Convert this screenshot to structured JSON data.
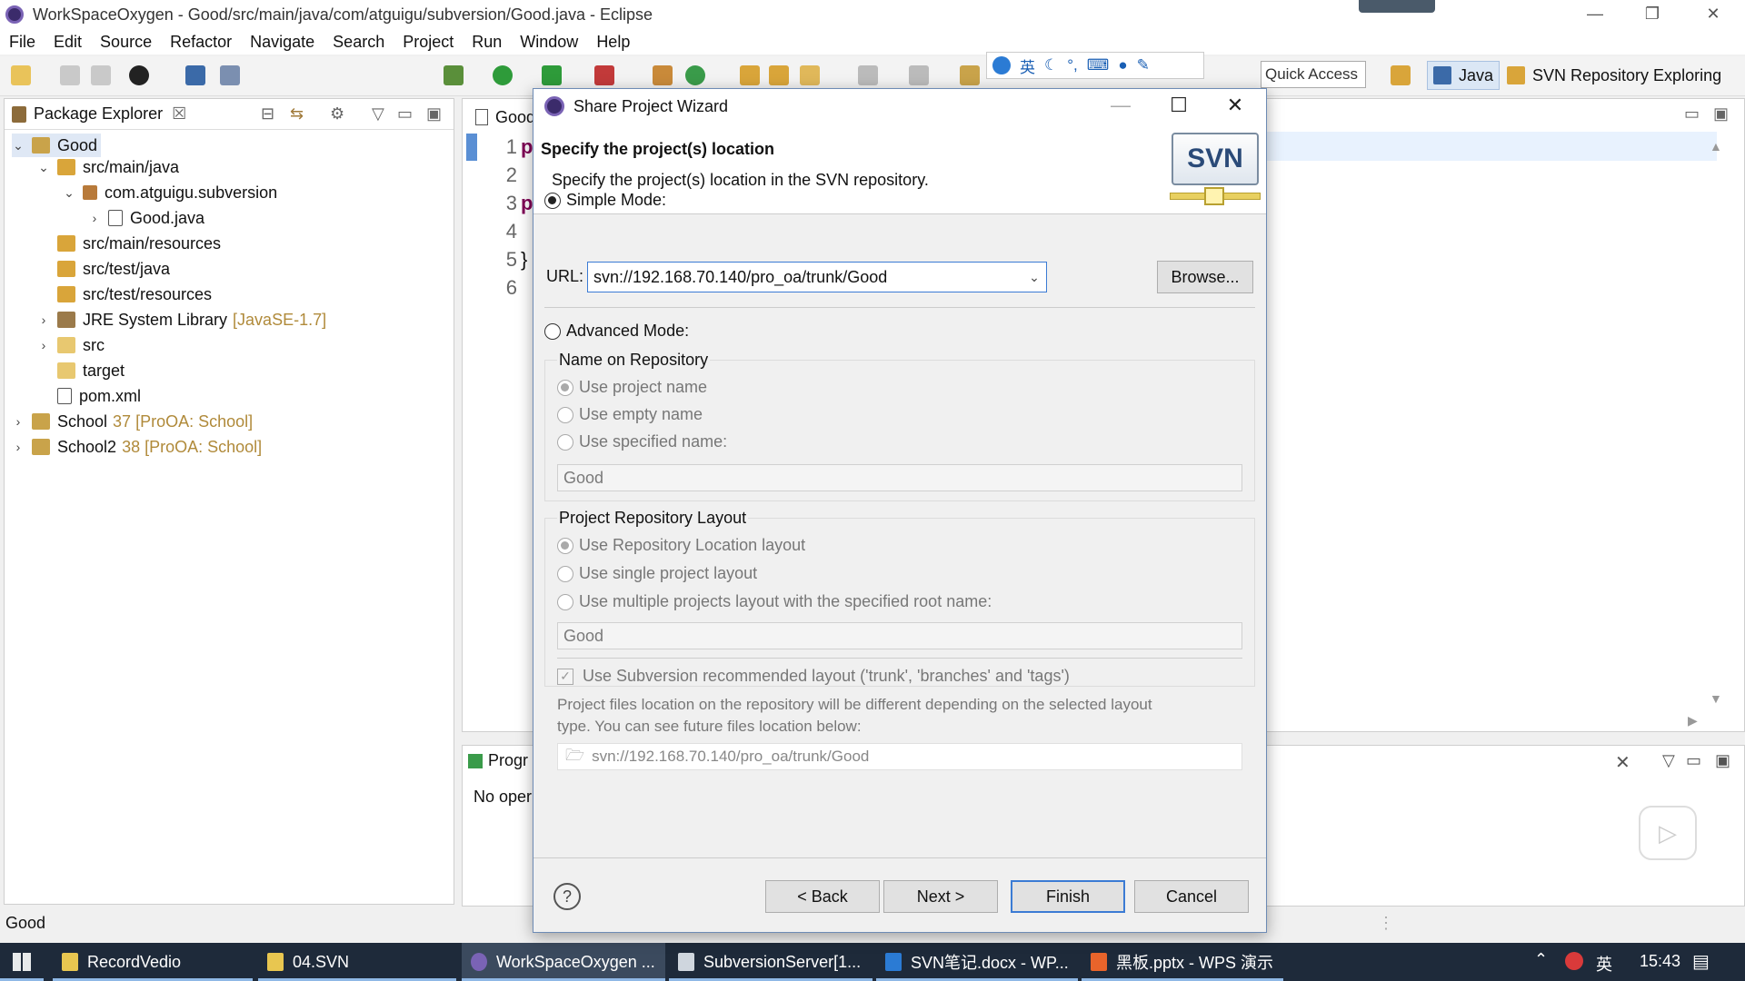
{
  "window": {
    "title": "WorkSpaceOxygen - Good/src/main/java/com/atguigu/subversion/Good.java - Eclipse"
  },
  "menu": [
    "File",
    "Edit",
    "Source",
    "Refactor",
    "Navigate",
    "Search",
    "Project",
    "Run",
    "Window",
    "Help"
  ],
  "toolbar": {
    "quick_access": "Quick Access",
    "perspectives": [
      "Java",
      "SVN Repository Exploring"
    ],
    "ime_label": "英"
  },
  "package_explorer": {
    "title": "Package Explorer",
    "items": [
      {
        "label": "Good",
        "deco": ""
      },
      {
        "label": "src/main/java",
        "deco": ""
      },
      {
        "label": "com.atguigu.subversion",
        "deco": ""
      },
      {
        "label": "Good.java",
        "deco": ""
      },
      {
        "label": "src/main/resources",
        "deco": ""
      },
      {
        "label": "src/test/java",
        "deco": ""
      },
      {
        "label": "src/test/resources",
        "deco": ""
      },
      {
        "label": "JRE System Library",
        "deco": "[JavaSE-1.7]"
      },
      {
        "label": "src",
        "deco": ""
      },
      {
        "label": "target",
        "deco": ""
      },
      {
        "label": "pom.xml",
        "deco": ""
      },
      {
        "label": "School",
        "deco": "37 [ProOA: School]"
      },
      {
        "label": "School2",
        "deco": "38 [ProOA: School]"
      }
    ]
  },
  "editor": {
    "tab": "Good",
    "line_numbers": [
      "1",
      "2",
      "3",
      "4",
      "5",
      "6"
    ],
    "code_lines": [
      "p",
      "",
      "p",
      "",
      "}",
      ""
    ]
  },
  "progress_view": {
    "title": "Progr",
    "body": "No oper"
  },
  "status_bar": {
    "text": "Good"
  },
  "dialog": {
    "title": "Share Project Wizard",
    "heading": "Specify the project(s) location",
    "subheading": "Specify the project(s) location in the SVN repository.",
    "logo_text": "SVN",
    "simple_mode": "Simple Mode:",
    "url_label": "URL:",
    "url_value": "svn://192.168.70.140/pro_oa/trunk/Good",
    "browse": "Browse...",
    "advanced_mode": "Advanced Mode:",
    "name_group": "Name on Repository",
    "name_options": [
      "Use project name",
      "Use empty name",
      "Use specified name:"
    ],
    "specified_name": "Good",
    "layout_group": "Project Repository Layout",
    "layout_options": [
      "Use Repository Location layout",
      "Use single project layout",
      "Use multiple projects layout with the specified root name:"
    ],
    "root_name": "Good",
    "recommended_layout": "Use Subversion recommended layout ('trunk', 'branches' and 'tags')",
    "note_line1": "Project files location on the repository will be different depending on the selected layout",
    "note_line2": "type. You can see future files location below:",
    "preview_path": "svn://192.168.70.140/pro_oa/trunk/Good",
    "buttons": {
      "back": "< Back",
      "next": "Next >",
      "finish": "Finish",
      "cancel": "Cancel"
    }
  },
  "taskbar": {
    "items": [
      "RecordVedio",
      "04.SVN",
      "WorkSpaceOxygen ...",
      "SubversionServer[1...",
      "SVN笔记.docx - WP...",
      "黑板.pptx - WPS 演示"
    ],
    "ime": "英",
    "clock": "15:43"
  }
}
